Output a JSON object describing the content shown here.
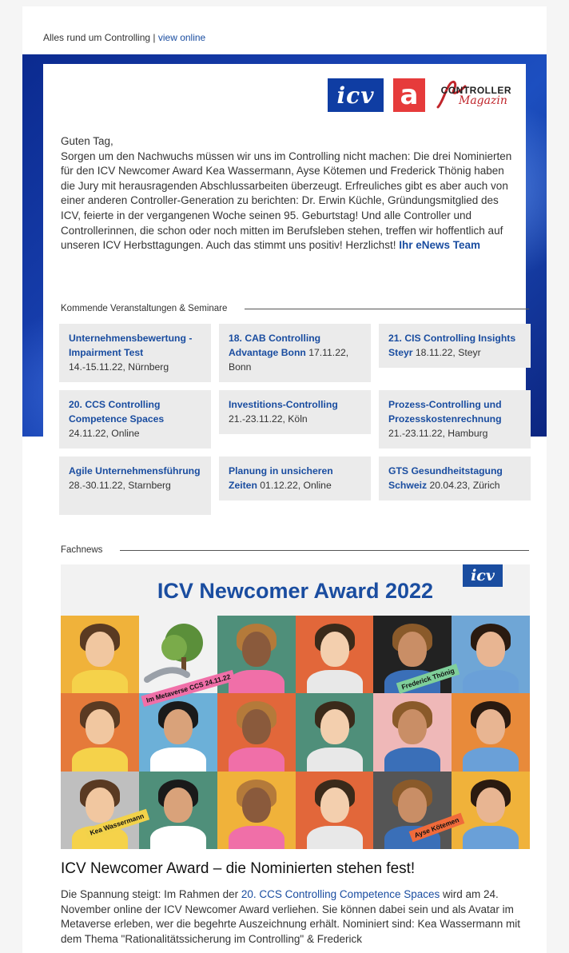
{
  "header": {
    "tagline": "Alles rund um Controlling | ",
    "view_online": "view online"
  },
  "logos": {
    "icv": "icv",
    "a": "a",
    "controller_top": "CONTROLLER",
    "controller_sub": "Magazin"
  },
  "intro": {
    "greeting": "Guten Tag,",
    "text": "Sorgen um den Nachwuchs müssen wir uns im Controlling nicht machen: Die drei Nominierten für den ICV Newcomer Award Kea Wassermann, Ayse Kötemen und Frederick Thönig haben die Jury mit herausragenden Abschlussarbeiten überzeugt. Erfreuliches gibt es aber auch von einer anderen Controller-Generation zu berichten: Dr. Erwin Küchle, Gründungsmitglied des ICV, feierte in der vergangenen Woche seinen 95. Geburtstag! Und alle Controller und Controllerinnen, die schon oder noch mitten im Berufsleben stehen, treffen wir hoffentlich auf unseren ICV Herbsttagungen. Auch das stimmt uns positiv! Herzlichst! ",
    "signature": "Ihr eNews Team"
  },
  "events_section": {
    "heading": "Kommende Veranstaltungen & Seminare",
    "items": [
      {
        "title": "Unternehmensbewertung - Impairment Test",
        "detail": "14.-15.11.22, Nürnberg"
      },
      {
        "title": "18. CAB Controlling Advantage Bonn",
        "detail": " 17.11.22, Bonn"
      },
      {
        "title": "21. CIS Controlling Insights Steyr",
        "detail": " 18.11.22, Steyr"
      },
      {
        "title": "20. CCS Controlling Competence Spaces",
        "detail": "24.11.22, Online"
      },
      {
        "title": "Investitions-Controlling",
        "detail": "21.-23.11.22, Köln"
      },
      {
        "title": "Prozess-Controlling und Prozesskostenrechnung",
        "detail": "21.-23.11.22, Hamburg"
      },
      {
        "title": "Agile Unternehmensführung",
        "detail": "28.-30.11.22, Starnberg"
      },
      {
        "title": "Planung in unsicheren Zeiten",
        "detail": " 01.12.22, Online"
      },
      {
        "title": "GTS Gesundheitstagung Schweiz",
        "detail": " 20.04.23, Zürich"
      }
    ]
  },
  "fachnews": {
    "heading": "Fachnews",
    "banner_title": "ICV Newcomer Award 2022",
    "banner_logo": "icv",
    "tags": {
      "metaverse": "Im Metaverse CCS 24.11.22",
      "frederick": "Frederick Thönig",
      "kea": "Kea Wassermann",
      "ayse": "Ayse Kötemen"
    },
    "tile_colors": [
      "#f0b23a",
      "#f2f2f2",
      "#4f8f7a",
      "#e2673a",
      "#222222",
      "#6fa6d6",
      "#e57a3a",
      "#6cb0d8",
      "#e2673a",
      "#4f8f7a",
      "#efb8b8",
      "#e88a3a",
      "#bfbfbf",
      "#4f8f7a",
      "#f0b23a",
      "#e2673a",
      "#555555",
      "#f0b23a"
    ],
    "article_title": "ICV Newcomer Award – die Nominierten stehen fest!",
    "article_pre": "Die Spannung steigt: Im Rahmen der ",
    "article_link": "20. CCS Controlling Competence Spaces",
    "article_post": " wird am 24. November online der ICV Newcomer Award verliehen. Sie können dabei sein und als Avatar im Metaverse erleben, wer die begehrte Auszeichnung erhält. Nominiert sind: Kea Wassermann mit dem Thema \"Rationalitätssicherung im Controlling\" & Frederick"
  }
}
